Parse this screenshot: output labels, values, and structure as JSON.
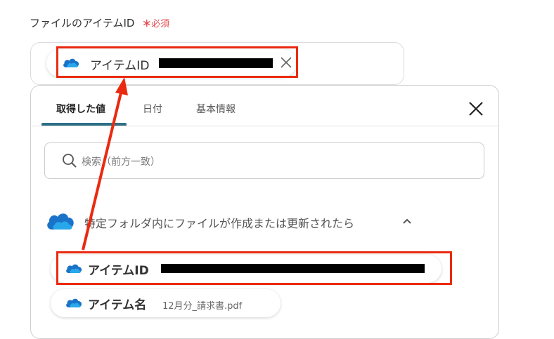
{
  "field": {
    "label": "ファイルのアイテムID",
    "required_star": "＊",
    "required_text": "必須"
  },
  "selected_chip": {
    "label": "アイテムID",
    "value_redacted": true,
    "icon": "onedrive-cloud-icon"
  },
  "tabs": [
    {
      "label": "取得した値",
      "active": true
    },
    {
      "label": "日付",
      "active": false
    },
    {
      "label": "基本情報",
      "active": false
    }
  ],
  "search": {
    "placeholder": "検索（前方一致）"
  },
  "section": {
    "title": "特定フォルダ内にファイルが作成または更新されたら",
    "expanded": true
  },
  "items": [
    {
      "label": "アイテムID",
      "value_redacted": true
    },
    {
      "label": "アイテム名",
      "value": "12月分_請求書.pdf"
    }
  ],
  "colors": {
    "accent_tab": "#2d6f86",
    "highlight": "#ea2a10",
    "required": "#e5484d",
    "onedrive": "#1a73c8"
  }
}
